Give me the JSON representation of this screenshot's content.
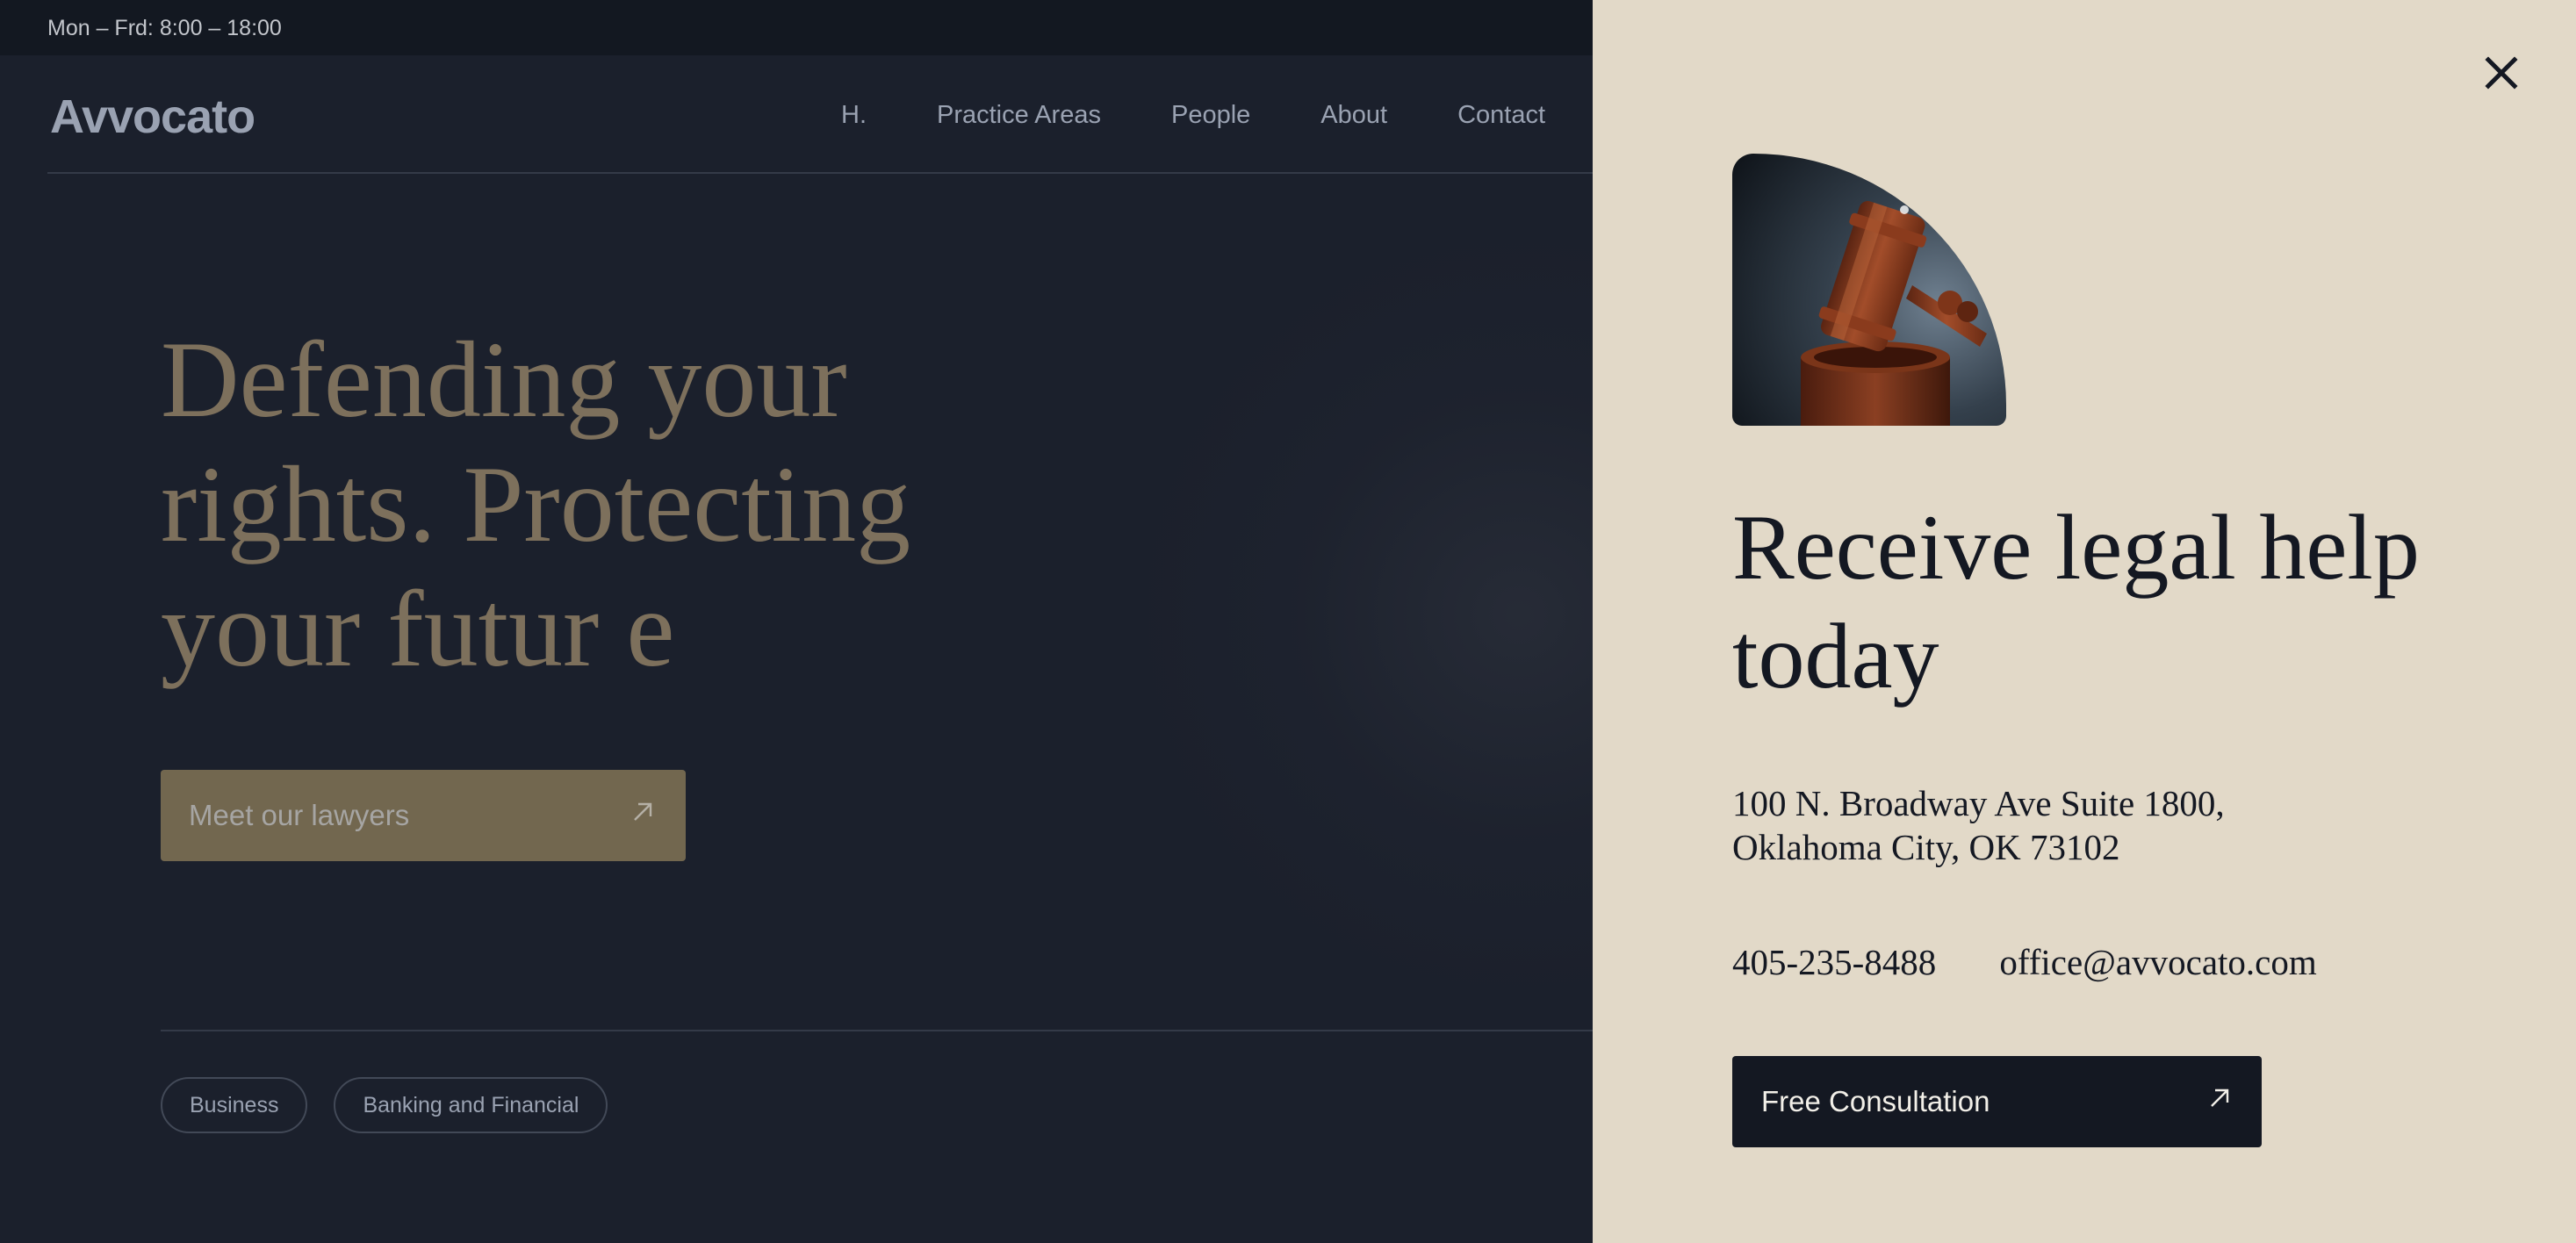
{
  "topbar": {
    "hours": "Mon – Frd: 8:00 – 18:00"
  },
  "header": {
    "logo": "Avvocato",
    "nav": [
      {
        "label": "H."
      },
      {
        "label": "Practice Areas"
      },
      {
        "label": "People"
      },
      {
        "label": "About"
      },
      {
        "label": "Contact"
      }
    ]
  },
  "hero": {
    "title_line1": "Defending your",
    "title_line2": "rights. Protecting",
    "title_line3": "your futur e",
    "cta_label": "Meet our lawyers",
    "cta_icon": "arrow-up-right-icon"
  },
  "practice_tags": [
    {
      "label": "Business"
    },
    {
      "label": "Banking and Financial"
    }
  ],
  "panel": {
    "close_icon": "close-icon",
    "title": "Receive legal help today",
    "address_line1": "100 N. Broadway Ave Suite 1800,",
    "address_line2": "Oklahoma City, OK 73102",
    "phone": "405-235-8488",
    "email": "office@avvocato.com",
    "cta_label": "Free Consultation",
    "cta_icon": "arrow-up-right-icon"
  },
  "colors": {
    "page_bg": "#1b202c",
    "topbar_bg": "#131821",
    "panel_bg": "#e2d9c8",
    "gold_accent": "#7d705c",
    "dark_button": "#141822"
  }
}
